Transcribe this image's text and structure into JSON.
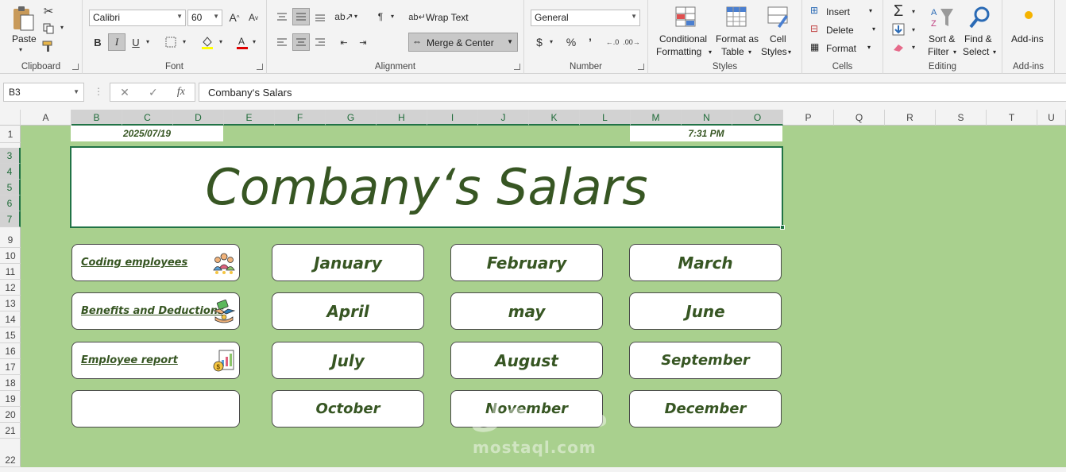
{
  "ribbon": {
    "clipboard": {
      "label": "Clipboard",
      "paste": "Paste"
    },
    "font": {
      "label": "Font",
      "name": "Calibri",
      "size": "60",
      "bold": "B",
      "italic": "I",
      "underline": "U"
    },
    "alignment": {
      "label": "Alignment",
      "wrap_text": "Wrap Text",
      "merge_center": "Merge & Center"
    },
    "number": {
      "label": "Number",
      "format": "General",
      "currency": "$",
      "percent": "%",
      "comma": "’"
    },
    "styles": {
      "label": "Styles",
      "conditional_1": "Conditional",
      "conditional_2": "Formatting",
      "format_table_1": "Format as",
      "format_table_2": "Table",
      "cell_styles_1": "Cell",
      "cell_styles_2": "Styles"
    },
    "cells": {
      "label": "Cells",
      "insert": "Insert",
      "delete": "Delete",
      "format": "Format"
    },
    "editing": {
      "label": "Editing",
      "sort_1": "Sort &",
      "sort_2": "Filter",
      "find_1": "Find &",
      "find_2": "Select"
    },
    "addins": {
      "label": "Add-ins",
      "button": "Add-ins"
    }
  },
  "formula_bar": {
    "name_box": "B3",
    "formula": "Combany‘s Salars"
  },
  "columns": [
    "A",
    "B",
    "C",
    "D",
    "E",
    "F",
    "G",
    "H",
    "I",
    "J",
    "K",
    "L",
    "M",
    "N",
    "O",
    "P",
    "Q",
    "R",
    "S",
    "T",
    "U"
  ],
  "rows": [
    "1",
    "3",
    "4",
    "5",
    "6",
    "7",
    "9",
    "10",
    "11",
    "12",
    "13",
    "14",
    "15",
    "16",
    "17",
    "18",
    "19",
    "20",
    "21",
    "22"
  ],
  "sheet": {
    "date": "2025/07/19",
    "time": "7:31 PM",
    "title": "Combany‘s Salars",
    "nav": [
      {
        "label": "Coding employees",
        "icon": "team-icon"
      },
      {
        "label": "Benefits and Deductions",
        "icon": "handshake-money-icon"
      },
      {
        "label": "Employee report",
        "icon": "report-chart-icon"
      },
      {
        "label": "",
        "icon": ""
      }
    ],
    "months": [
      [
        "January",
        "February",
        "March"
      ],
      [
        "April",
        "may",
        "June"
      ],
      [
        "July",
        "August",
        "September"
      ],
      [
        "October",
        "November",
        "December"
      ]
    ],
    "watermark": "مستقل",
    "watermark_url": "mostaql.com"
  },
  "colors": {
    "sheet_bg": "#a9d08e",
    "title_text": "#375623",
    "excel_green": "#217346"
  }
}
